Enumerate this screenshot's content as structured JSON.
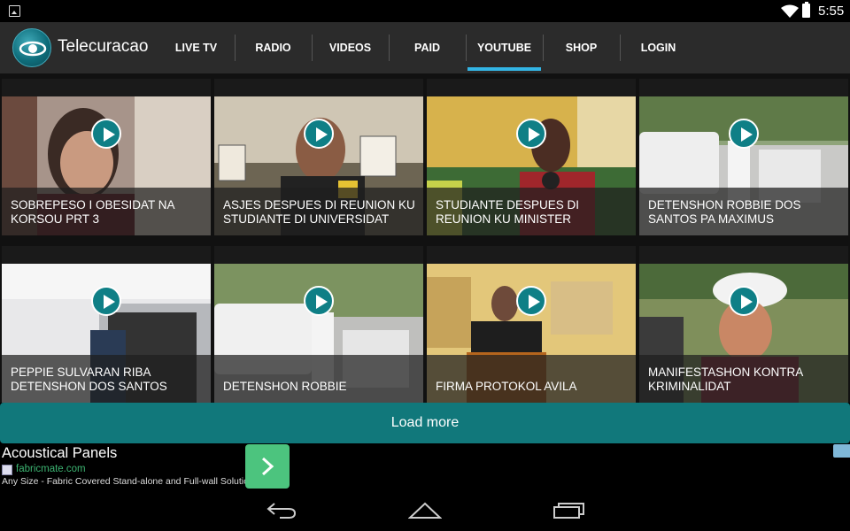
{
  "status_bar": {
    "time": "5:55",
    "icons": [
      "gallery-icon",
      "wifi-icon",
      "battery-icon"
    ]
  },
  "app": {
    "title": "Telecuracao"
  },
  "nav": {
    "items": [
      {
        "label": "LIVE TV",
        "active": false
      },
      {
        "label": "RADIO",
        "active": false
      },
      {
        "label": "VIDEOS",
        "active": false
      },
      {
        "label": "PAID",
        "active": false
      },
      {
        "label": "YOUTUBE",
        "active": true
      },
      {
        "label": "SHOP",
        "active": false
      },
      {
        "label": "LOGIN",
        "active": false
      }
    ]
  },
  "videos": [
    {
      "title": "SOBREPESO I OBESIDAT NA KORSOU PRT 3"
    },
    {
      "title": "ASJES DESPUES DI REUNION KU STUDIANTE DI UNIVERSIDAT"
    },
    {
      "title": "STUDIANTE DESPUES DI REUNION KU MINISTER"
    },
    {
      "title": "DETENSHON ROBBIE DOS SANTOS PA MAXIMUS"
    },
    {
      "title": "PEPPIE SULVARAN RIBA DETENSHON DOS SANTOS"
    },
    {
      "title": "DETENSHON ROBBIE"
    },
    {
      "title": "FIRMA PROTOKOL AVILA"
    },
    {
      "title": "MANIFESTASHON KONTRA KRIMINALIDAT"
    }
  ],
  "load_more": {
    "label": "Load more"
  },
  "ad": {
    "title": "Acoustical Panels",
    "url": "fabricmate.com",
    "description": "Any Size - Fabric Covered Stand-alone and Full-wall Solutions"
  },
  "colors": {
    "accent_tab_indicator": "#33b5e5",
    "load_more_bg": "#11787b",
    "play_button": "#0f7f86",
    "ad_button": "#4cc47e",
    "ad_url": "#3cb371"
  }
}
